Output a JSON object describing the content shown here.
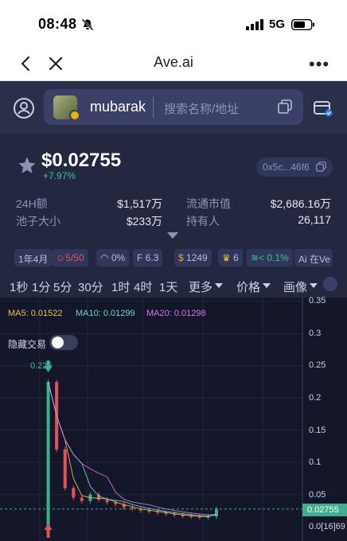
{
  "status": {
    "time": "08:48",
    "network": "5G"
  },
  "browser": {
    "title": "Ave.ai"
  },
  "header": {
    "token_name": "mubarak",
    "search_placeholder": "搜索名称/地址"
  },
  "token": {
    "price": "$0.02755",
    "change": "+7.97%",
    "address": "0x5c...46f6",
    "stats": [
      {
        "label": "24H额",
        "value": "$1,517万"
      },
      {
        "label": "流通市值",
        "value": "$2,686.16万"
      },
      {
        "label": "池子大小",
        "value": "$233万"
      },
      {
        "label": "持有人",
        "value": "26,117"
      }
    ],
    "chips": [
      {
        "icon": "",
        "text": "1年4月"
      },
      {
        "icon": "users-icon",
        "text": "5/50"
      },
      {
        "icon": "chef-icon",
        "text": "0%"
      },
      {
        "icon": "f-score-icon",
        "text": "F 6.3"
      },
      {
        "icon": "moneybag-icon",
        "text": "1249"
      },
      {
        "icon": "trophy-icon",
        "text": "6"
      },
      {
        "icon": "cash-icon",
        "text": "< 0.1%"
      },
      {
        "icon": "ai-icon",
        "text": "Ai 在Ve"
      }
    ]
  },
  "timeframes": [
    "1秒",
    "1分",
    "5分",
    "30分",
    "1时",
    "4时",
    "1天"
  ],
  "dropdowns": [
    "更多",
    "价格",
    "画像"
  ],
  "chart": {
    "ma5": "MA5: 0.01522",
    "ma10": "MA10: 0.01299",
    "ma20": "MA20: 0.01298",
    "hide_trades_label": "隐藏交易",
    "peak_label": "0.225",
    "current_price": "0.02755",
    "y_ticks": [
      "0.35",
      "0.3",
      "0.25",
      "0.2",
      "0.15",
      "0.1",
      "0.05",
      "0.0[16]69"
    ],
    "colors": {
      "up": "#3fae8c",
      "down": "#e0535f",
      "ma5": "#e8c15c",
      "ma10": "#6fd3c7",
      "ma20": "#d27ae6"
    }
  },
  "chart_data": {
    "type": "line",
    "ylim": [
      0,
      0.35
    ],
    "x": [
      1,
      2,
      3,
      4,
      5,
      6,
      7,
      8,
      9,
      10,
      11,
      12,
      13,
      14,
      15,
      16,
      17,
      18,
      19,
      20,
      21,
      22
    ],
    "series": [
      {
        "values": [
          0.0,
          0.225,
          0.12,
          0.06,
          0.045,
          0.04,
          0.05,
          0.042,
          0.038,
          0.035,
          0.03,
          0.028,
          0.025,
          0.024,
          0.022,
          0.02,
          0.018,
          0.017,
          0.016,
          0.015,
          0.016,
          0.02755
        ]
      }
    ]
  }
}
